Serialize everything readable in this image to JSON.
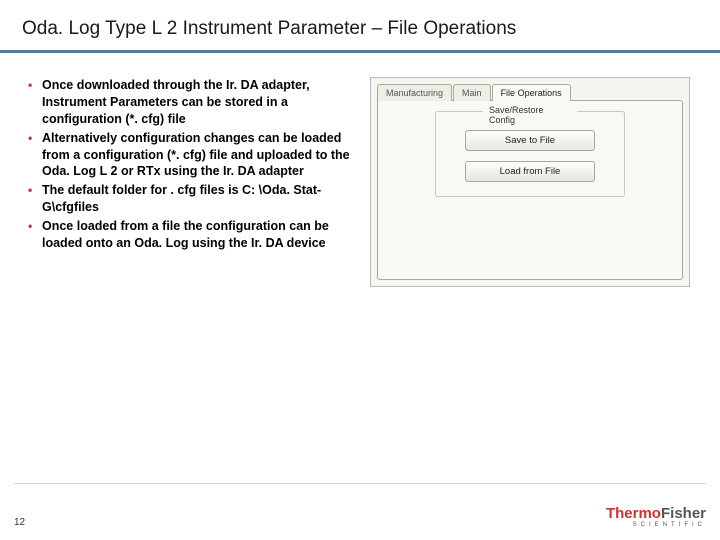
{
  "title": "Oda. Log Type L 2 Instrument Parameter – File Operations",
  "bullets": [
    "Once downloaded through the Ir. DA adapter, Instrument Parameters can be stored in a configuration (*. cfg) file",
    "Alternatively configuration changes can be loaded from a configuration (*. cfg) file and uploaded to the Oda. Log L 2 or RTx using the Ir. DA adapter",
    "The default folder for . cfg files is C: \\Oda. Stat-G\\cfgfiles",
    "Once loaded from a file the configuration can be loaded onto an Oda. Log using the Ir. DA device"
  ],
  "panel": {
    "tabs": [
      {
        "label": "Manufacturing",
        "active": false
      },
      {
        "label": "Main",
        "active": false
      },
      {
        "label": "File Operations",
        "active": true
      }
    ],
    "group_title": "Save/Restore Config",
    "buttons": {
      "save": "Save to File",
      "load": "Load from File"
    }
  },
  "page_number": "12",
  "logo": {
    "thermo": "Thermo",
    "fisher": "Fisher",
    "sub": "SCIENTIFIC"
  }
}
